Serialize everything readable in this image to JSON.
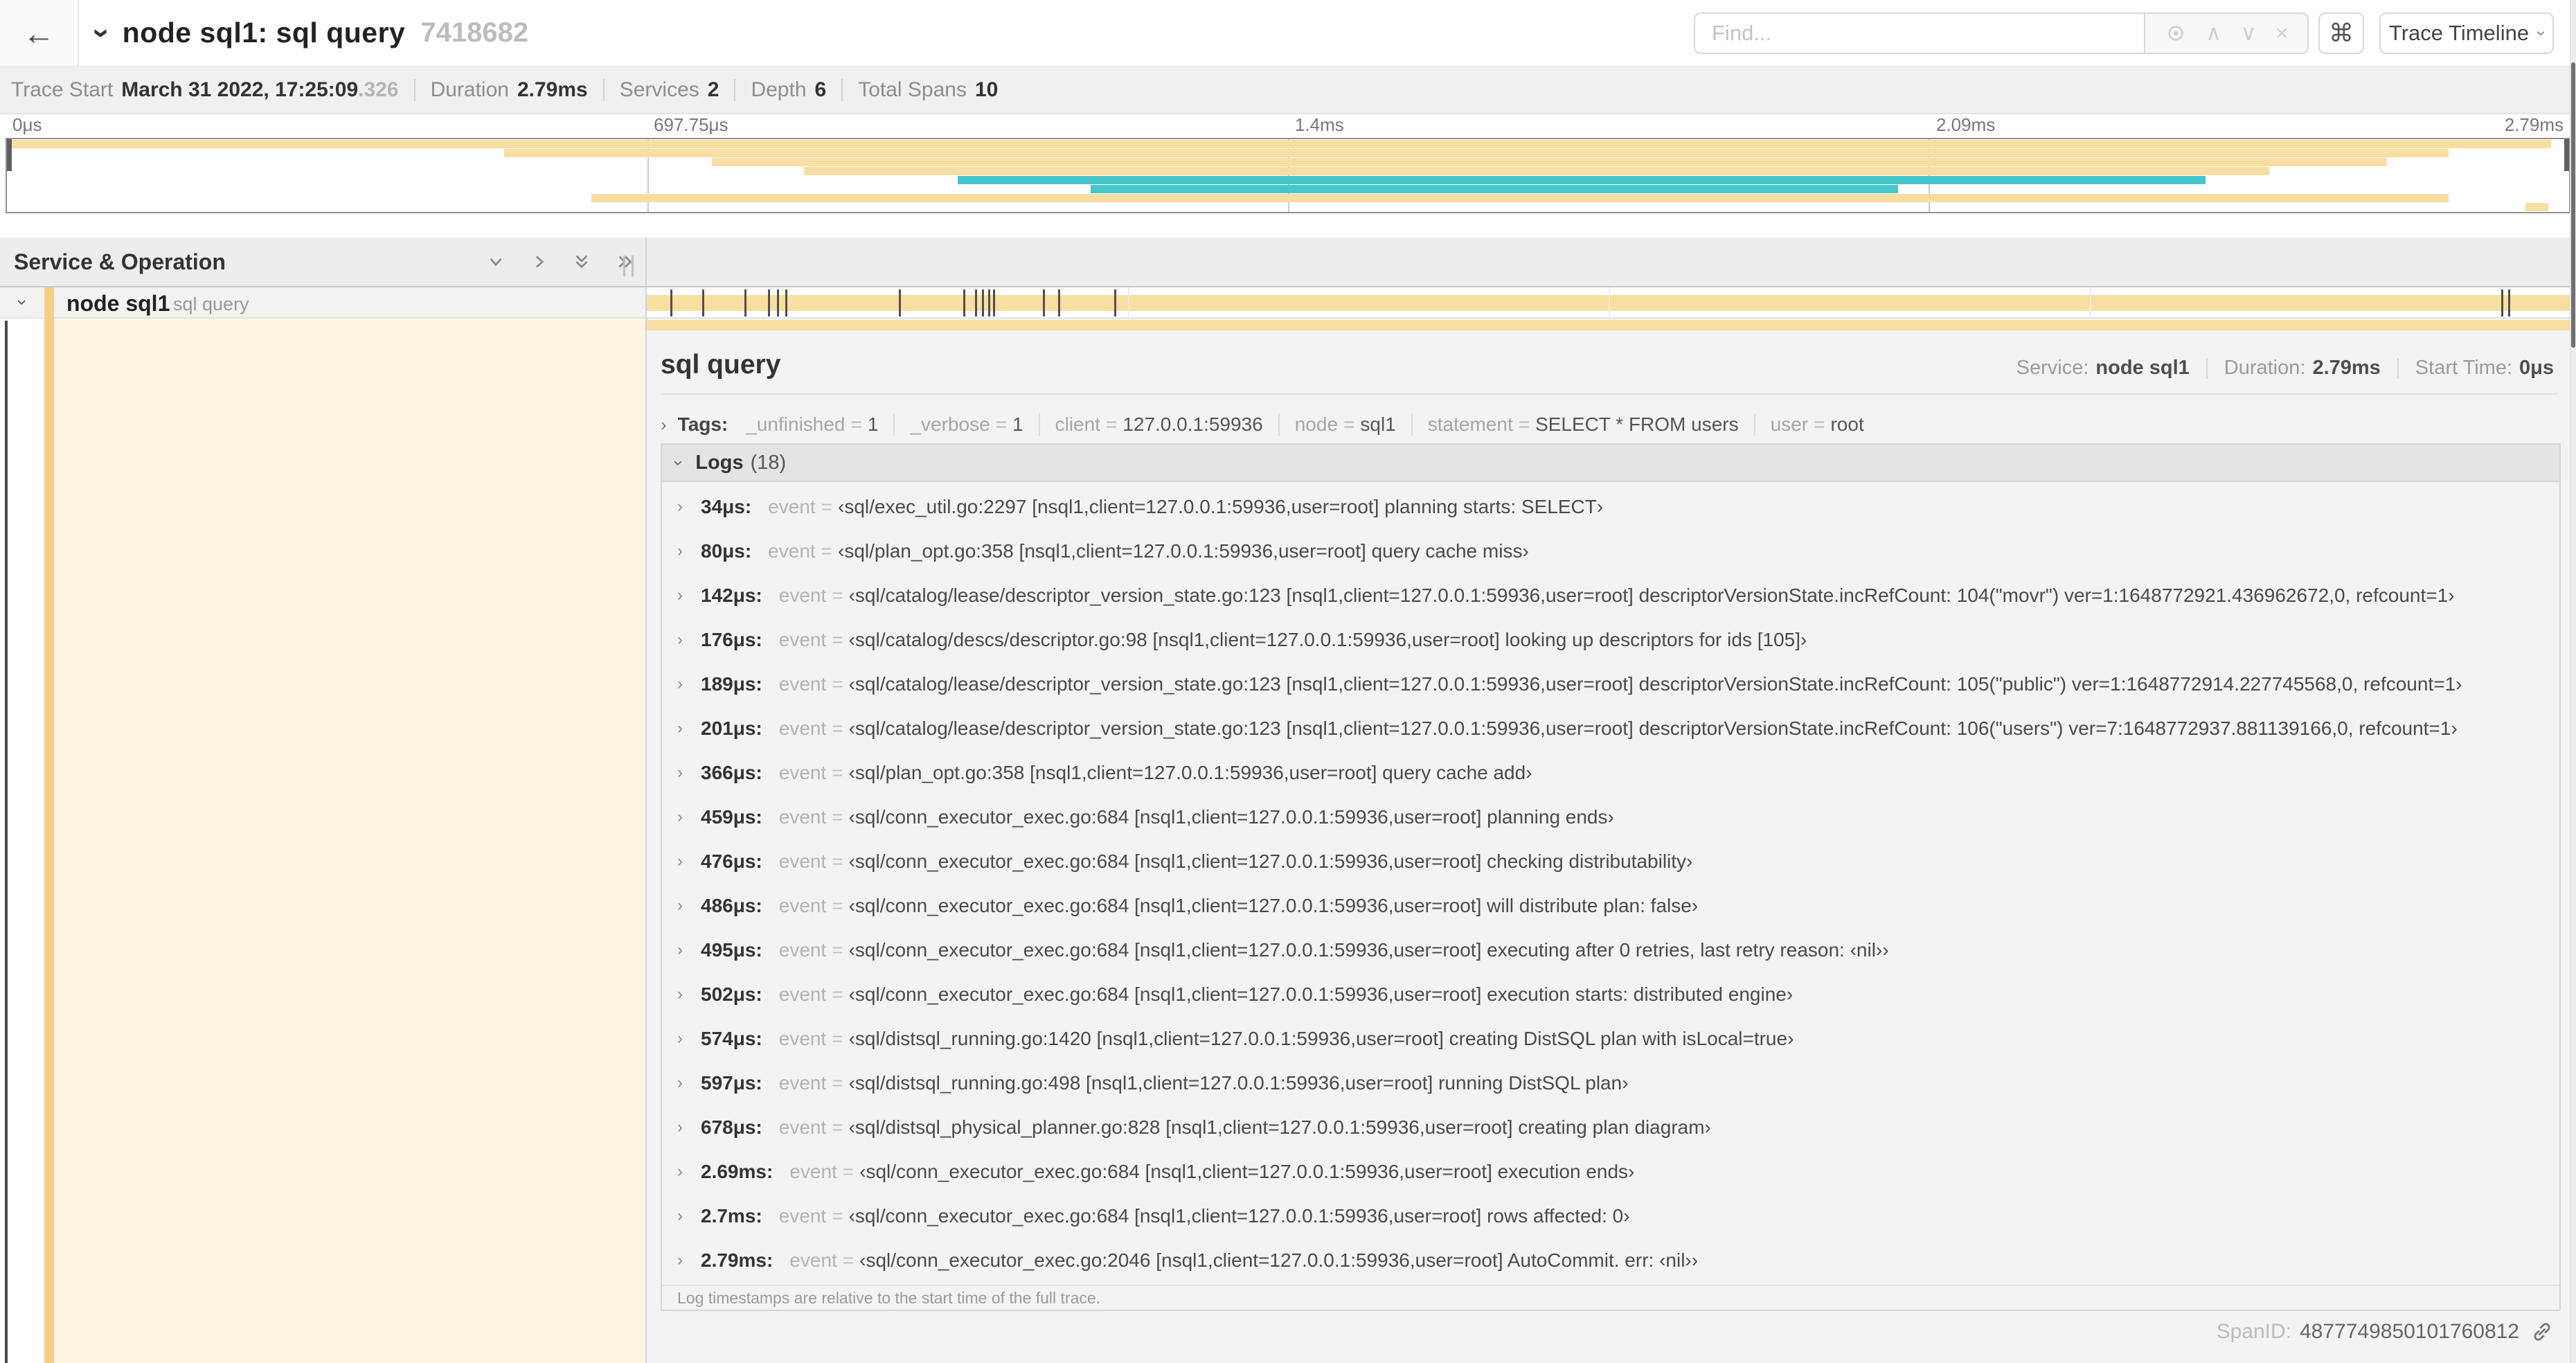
{
  "colors": {
    "tan": "#f8dea0",
    "teal": "#45c6ca",
    "cream": "#fdf5e2",
    "accent_strip": "#f5cf87",
    "tick_mark": "#4f4f4f"
  },
  "header": {
    "back_icon": "←",
    "title": "node sql1: sql query",
    "trace_id": "7418682",
    "find_placeholder": "Find...",
    "command_label": "⌘",
    "view_button": "Trace Timeline"
  },
  "trace_info": {
    "items": [
      {
        "label": "Trace Start",
        "value": "March 31 2022, 17:25:09",
        "suffix": ".326"
      },
      {
        "label": "Duration",
        "value": "2.79ms"
      },
      {
        "label": "Services",
        "value": "2"
      },
      {
        "label": "Depth",
        "value": "6"
      },
      {
        "label": "Total Spans",
        "value": "10"
      }
    ]
  },
  "timeline": {
    "duration_us": 2790,
    "ticks": [
      {
        "label": "0μs",
        "pos": 0
      },
      {
        "label": "697.75μs",
        "pos": 25
      },
      {
        "label": "1.4ms",
        "pos": 50
      },
      {
        "label": "2.09ms",
        "pos": 75
      },
      {
        "label": "2.79ms",
        "pos": 100
      }
    ],
    "minimap_bars": [
      {
        "start": 0,
        "end": 99.3,
        "color": "tan",
        "row": 0
      },
      {
        "start": 19.4,
        "end": 95.3,
        "color": "tan",
        "row": 1
      },
      {
        "start": 27.5,
        "end": 92.9,
        "color": "tan",
        "row": 2
      },
      {
        "start": 31.1,
        "end": 88.3,
        "color": "tan",
        "row": 3
      },
      {
        "start": 37.1,
        "end": 85.8,
        "color": "teal",
        "row": 4
      },
      {
        "start": 42.3,
        "end": 73.8,
        "color": "teal",
        "row": 5
      },
      {
        "start": 22.8,
        "end": 95.3,
        "color": "tan",
        "row": 6
      },
      {
        "start": 98.3,
        "end": 99.2,
        "color": "tan",
        "row": 7
      }
    ]
  },
  "left_header": {
    "title": "Service & Operation"
  },
  "span_row": {
    "service": "node sql1",
    "operation": "sql query",
    "log_marks_us": [
      34,
      80,
      142,
      176,
      189,
      201,
      366,
      459,
      476,
      486,
      495,
      502,
      574,
      597,
      678,
      2690,
      2700
    ]
  },
  "detail": {
    "title": "sql query",
    "meta": {
      "service_label": "Service:",
      "service": "node sql1",
      "duration_label": "Duration:",
      "duration": "2.79ms",
      "start_label": "Start Time:",
      "start": "0μs"
    },
    "tags_label": "Tags:",
    "tags": [
      {
        "key": "_unfinished",
        "value": "1"
      },
      {
        "key": "_verbose",
        "value": "1"
      },
      {
        "key": "client",
        "value": "127.0.0.1:59936"
      },
      {
        "key": "node",
        "value": "sql1"
      },
      {
        "key": "statement",
        "value": "SELECT * FROM users"
      },
      {
        "key": "user",
        "value": "root"
      }
    ],
    "logs_label": "Logs",
    "logs_count": "(18)",
    "log_key": "event",
    "logs": [
      {
        "t": "34μs:",
        "msg": "‹sql/exec_util.go:2297 [nsql1,client=127.0.0.1:59936,user=root] planning starts: SELECT›"
      },
      {
        "t": "80μs:",
        "msg": "‹sql/plan_opt.go:358 [nsql1,client=127.0.0.1:59936,user=root] query cache miss›"
      },
      {
        "t": "142μs:",
        "msg": "‹sql/catalog/lease/descriptor_version_state.go:123 [nsql1,client=127.0.0.1:59936,user=root] descriptorVersionState.incRefCount: 104(\"movr\") ver=1:1648772921.436962672,0, refcount=1›"
      },
      {
        "t": "176μs:",
        "msg": "‹sql/catalog/descs/descriptor.go:98 [nsql1,client=127.0.0.1:59936,user=root] looking up descriptors for ids [105]›"
      },
      {
        "t": "189μs:",
        "msg": "‹sql/catalog/lease/descriptor_version_state.go:123 [nsql1,client=127.0.0.1:59936,user=root] descriptorVersionState.incRefCount: 105(\"public\") ver=1:1648772914.227745568,0, refcount=1›"
      },
      {
        "t": "201μs:",
        "msg": "‹sql/catalog/lease/descriptor_version_state.go:123 [nsql1,client=127.0.0.1:59936,user=root] descriptorVersionState.incRefCount: 106(\"users\") ver=7:1648772937.881139166,0, refcount=1›"
      },
      {
        "t": "366μs:",
        "msg": "‹sql/plan_opt.go:358 [nsql1,client=127.0.0.1:59936,user=root] query cache add›"
      },
      {
        "t": "459μs:",
        "msg": "‹sql/conn_executor_exec.go:684 [nsql1,client=127.0.0.1:59936,user=root] planning ends›"
      },
      {
        "t": "476μs:",
        "msg": "‹sql/conn_executor_exec.go:684 [nsql1,client=127.0.0.1:59936,user=root] checking distributability›"
      },
      {
        "t": "486μs:",
        "msg": "‹sql/conn_executor_exec.go:684 [nsql1,client=127.0.0.1:59936,user=root] will distribute plan: false›"
      },
      {
        "t": "495μs:",
        "msg": "‹sql/conn_executor_exec.go:684 [nsql1,client=127.0.0.1:59936,user=root] executing after 0 retries, last retry reason: ‹nil››"
      },
      {
        "t": "502μs:",
        "msg": "‹sql/conn_executor_exec.go:684 [nsql1,client=127.0.0.1:59936,user=root] execution starts: distributed engine›"
      },
      {
        "t": "574μs:",
        "msg": "‹sql/distsql_running.go:1420 [nsql1,client=127.0.0.1:59936,user=root] creating DistSQL plan with isLocal=true›"
      },
      {
        "t": "597μs:",
        "msg": "‹sql/distsql_running.go:498 [nsql1,client=127.0.0.1:59936,user=root] running DistSQL plan›"
      },
      {
        "t": "678μs:",
        "msg": "‹sql/distsql_physical_planner.go:828 [nsql1,client=127.0.0.1:59936,user=root] creating plan diagram›"
      },
      {
        "t": "2.69ms:",
        "msg": "‹sql/conn_executor_exec.go:684 [nsql1,client=127.0.0.1:59936,user=root] execution ends›"
      },
      {
        "t": "2.7ms:",
        "msg": "‹sql/conn_executor_exec.go:684 [nsql1,client=127.0.0.1:59936,user=root] rows affected: 0›"
      },
      {
        "t": "2.79ms:",
        "msg": "‹sql/conn_executor_exec.go:2046 [nsql1,client=127.0.0.1:59936,user=root] AutoCommit. err: ‹nil››"
      }
    ],
    "footer_note": "Log timestamps are relative to the start time of the full trace.",
    "spanid_label": "SpanID:",
    "spanid": "4877749850101760812"
  }
}
